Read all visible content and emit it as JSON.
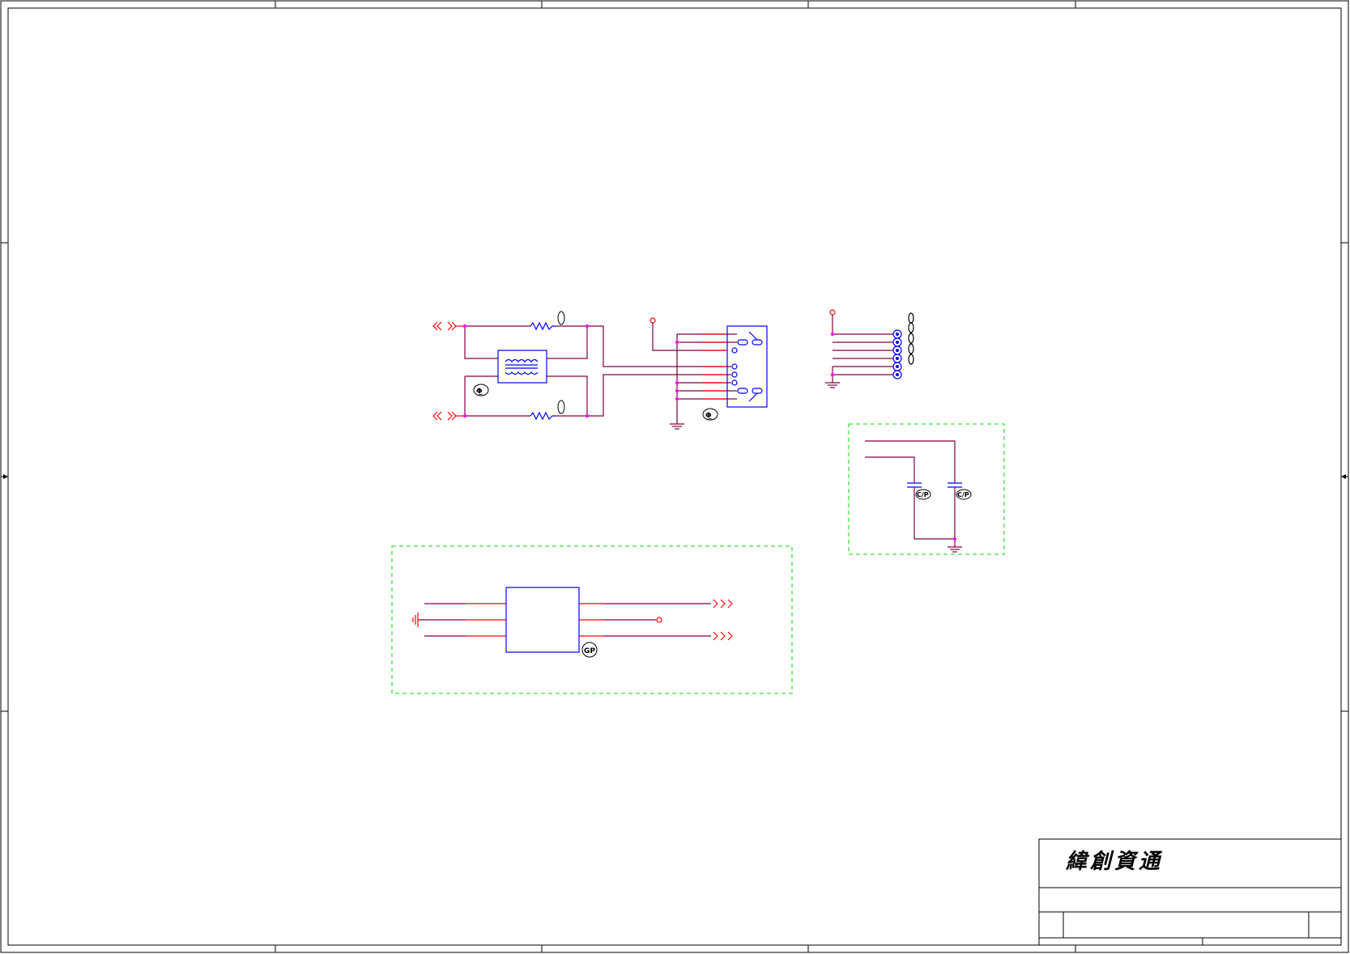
{
  "title_block": {
    "company_name": "緯創資通"
  },
  "part_tags": {
    "transformer_tag": "Φ̲",
    "connector_tag": "Φ̲",
    "regulator_tag": "GP",
    "cap_tag_1": "C/P",
    "cap_tag_2": "C/P"
  },
  "colors": {
    "wire": "#800040",
    "pin": "#ff0000",
    "component": "#0000ff",
    "junction": "#ff00ff",
    "group_box": "#00dd00",
    "frame": "#000000"
  }
}
